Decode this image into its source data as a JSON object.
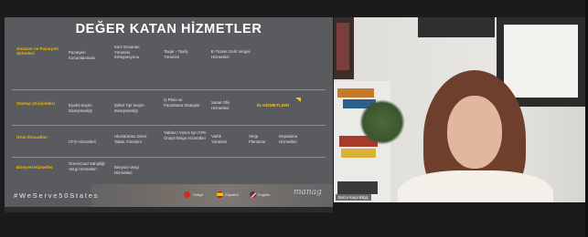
{
  "slide": {
    "title": "DEĞER KATAN HİZMETLER",
    "categories": [
      {
        "label": "Amazon ve Pazaryeri Şirketleri"
      },
      {
        "label": "Startup (Girişimler)"
      },
      {
        "label": "Ürün Ihracatları"
      },
      {
        "label": "Bireysel Hizmetler"
      }
    ],
    "services": {
      "r1": [
        "Pazaryeri Konumlanması",
        "Kerz Envanter Yönetimi Entegrasyonu",
        "Taxjar - Taxify Yönetimi",
        "E-Ticaret Gelir Vergisi Hizmetleri"
      ],
      "r2": [
        "Eyalet Seçim Danışmanlığı",
        "Şirket Tipi Seçim Danışmanlığı",
        "İş Planı ve Pazarlama Stratejisi",
        "Sanal Ofis Hizmetleri",
        "İK HİZMETLERİ"
      ],
      "r3": [
        "CFO Hizmetleri",
        "Uluslararası Döviz Takas Yönetimi",
        "Yabancı Vizesi İçin CPA Onaylı Belge Hizmetleri",
        "Varlık Yönetimi",
        "Vergi Planlama",
        "Depolama Hizmetleri"
      ],
      "r4": [
        "GreenCard Sahipliği Vergi Hizmetleri",
        "Bireysel Vergi Hizmetleri"
      ]
    },
    "hashtag": "#WeServe50States",
    "languages": [
      "Türkçe",
      "Español",
      "English"
    ],
    "logo_text": "manag"
  },
  "camera": {
    "participant_name": "Burcu Kaya Bilgiç"
  },
  "colors": {
    "slide_bg": "#5a5b5e",
    "accent": "#f2b600",
    "page_bg": "#1b1b1b"
  }
}
